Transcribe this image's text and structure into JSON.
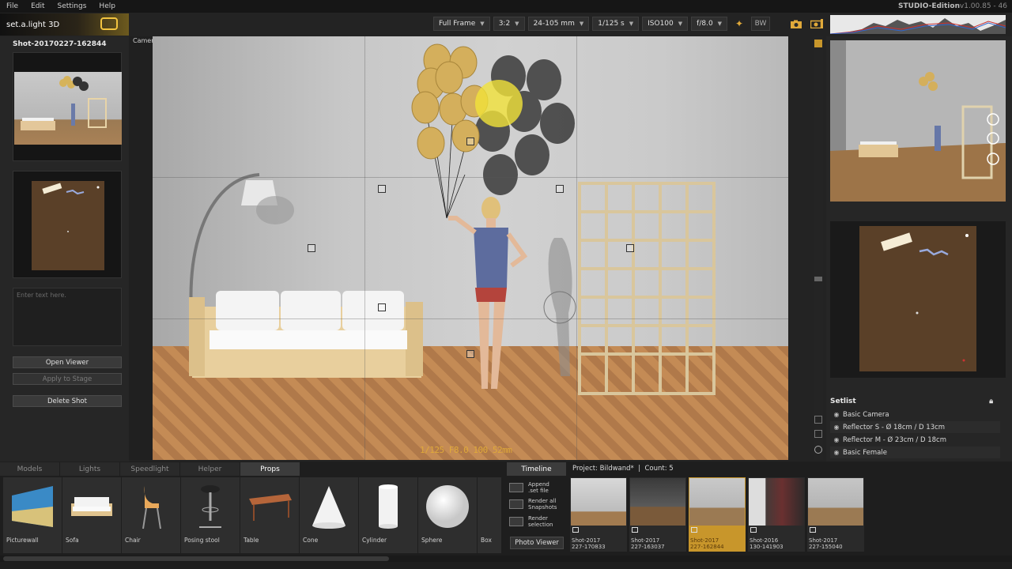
{
  "menu": {
    "file": "File",
    "edit": "Edit",
    "settings": "Settings",
    "help": "Help"
  },
  "edition": "STUDIO-Edition",
  "version": "v1.00.85 - 46",
  "logo": "set.a.light 3D",
  "camera_settings": {
    "frame": "Full Frame",
    "ratio": "3:2",
    "lens": "24-105 mm",
    "shutter": "1/125 s",
    "iso": "ISO100",
    "aperture": "f/8.0",
    "bw": "BW"
  },
  "left": {
    "shot_title": "Shot-20170227-162844",
    "note_placeholder": "Enter text here.",
    "open_viewer": "Open Viewer",
    "apply_stage": "Apply to Stage",
    "delete_shot": "Delete Shot"
  },
  "viewport": {
    "label": "Camera",
    "readout": "1/125  F8.0  100  52mm"
  },
  "setlist": {
    "title": "Setlist",
    "items": [
      "Basic Camera",
      "Reflector S - Ø 18cm / D 13cm",
      "Reflector M - Ø 23cm / D 18cm",
      "Basic Female"
    ]
  },
  "bottom_tabs": [
    "Models",
    "Lights",
    "Speedlight",
    "Helper",
    "Props"
  ],
  "props": [
    "Picturewall",
    "Sofa",
    "Chair",
    "Posing stool",
    "Table",
    "Cone",
    "Cylinder",
    "Sphere",
    "Box"
  ],
  "timeline": {
    "tab": "Timeline",
    "project": "Project: Bildwand*",
    "count": "Count: 5",
    "append": "Append\n.set file",
    "render_all": "Render all\nSnapshots",
    "render_sel": "Render\nselection",
    "photo_viewer": "Photo Viewer"
  },
  "snapshots": [
    {
      "line1": "Shot-2017",
      "line2": "227-170833"
    },
    {
      "line1": "Shot-2017",
      "line2": "227-163037"
    },
    {
      "line1": "Shot-2017",
      "line2": "227-162844"
    },
    {
      "line1": "Shot-2016",
      "line2": "130-141903"
    },
    {
      "line1": "Shot-2017",
      "line2": "227-155040"
    }
  ],
  "colors": {
    "accent": "#e0a93a",
    "selected_snapshot": "#c8962b"
  }
}
